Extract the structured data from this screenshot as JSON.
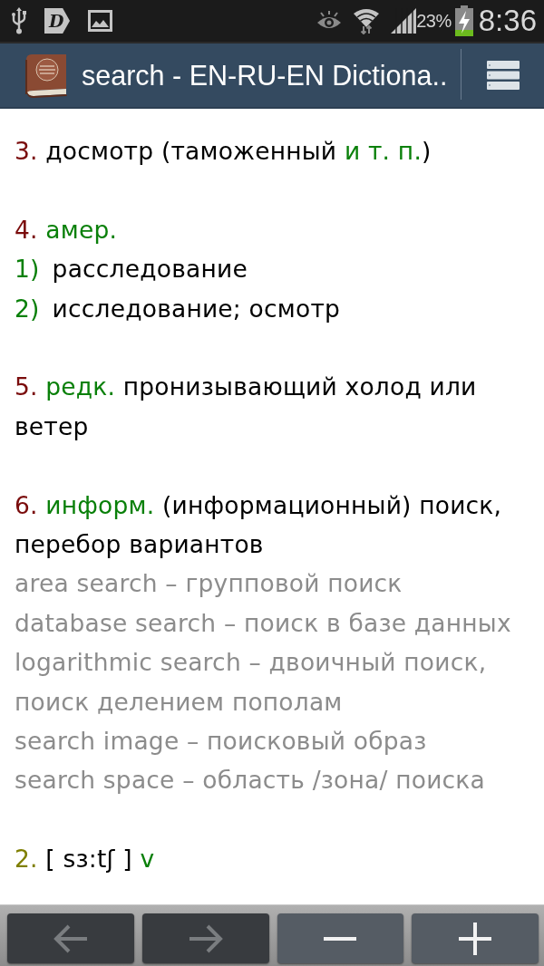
{
  "status_bar": {
    "notification_letter": "D",
    "battery_percent": "23%",
    "time": "8:36"
  },
  "app_bar": {
    "title": "search - EN-RU-EN Dictiona.."
  },
  "entry": [
    {
      "kind": "sense",
      "number": "3.",
      "parts": [
        {
          "kind": "text",
          "text": "досмотр (таможенный "
        },
        {
          "kind": "label",
          "text": "и т. п."
        },
        {
          "kind": "text",
          "text": ")"
        }
      ]
    },
    {
      "kind": "sense",
      "number": "4.",
      "parts": [
        {
          "kind": "label",
          "text": "амер."
        }
      ],
      "items": [
        {
          "number": "1)",
          "text": "расследование"
        },
        {
          "number": "2)",
          "text": "исследование; осмотр"
        }
      ]
    },
    {
      "kind": "sense",
      "number": "5.",
      "parts": [
        {
          "kind": "label",
          "text": "редк."
        },
        {
          "kind": "text",
          "text": " пронизывающий холод или ветер"
        }
      ]
    },
    {
      "kind": "sense",
      "number": "6.",
      "parts": [
        {
          "kind": "label",
          "text": "информ."
        },
        {
          "kind": "text",
          "text": " (информационный) поиск, перебор вариантов"
        }
      ],
      "examples": [
        "area search – групповой поиск",
        "database search – поиск в базе данных",
        "logarithmic search – двоичный поиск, поиск делением пополам",
        "search image – поисковый образ",
        "search space – область /зона/ поиска"
      ]
    },
    {
      "kind": "homonym",
      "number": "2.",
      "parts": [
        {
          "kind": "text",
          "text": "[ sɜ:tʃ ] "
        },
        {
          "kind": "label",
          "text": "v"
        }
      ]
    }
  ],
  "bottom_bar": {
    "buttons": [
      {
        "kind": "back",
        "disabled": true
      },
      {
        "kind": "forward",
        "disabled": true
      },
      {
        "kind": "zoom_out",
        "disabled": false
      },
      {
        "kind": "zoom_in",
        "disabled": false
      }
    ]
  }
}
